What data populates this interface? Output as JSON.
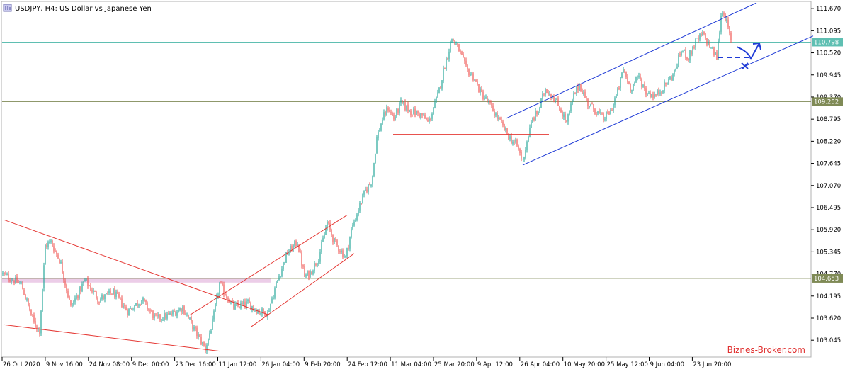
{
  "header": {
    "title": "USDJPY, H4:  US Dollar vs Japanese Yen",
    "icon": "chart-window-icon"
  },
  "watermark": "Biznes-Broker.com",
  "colors": {
    "bull": "#26a69a",
    "bear": "#ef5350",
    "red_line": "#e53935",
    "blue_line": "#1f3bd6",
    "teal_level": "#5fbfb2",
    "olive_level": "#7f8a56",
    "pink_band": "#e9c4e4",
    "label_dark_text": "#ffffff"
  },
  "chart_data": {
    "type": "candlestick",
    "symbol": "USDJPY",
    "timeframe": "H4",
    "ylim": [
      102.68,
      111.82
    ],
    "y_ticks": [
      "111.670",
      "111.095",
      "110.520",
      "109.945",
      "109.370",
      "108.795",
      "108.220",
      "107.645",
      "107.070",
      "106.495",
      "105.920",
      "105.345",
      "104.770",
      "104.195",
      "103.620",
      "103.045"
    ],
    "x_ticks": [
      "26 Oct 2020",
      "9 Nov 16:00",
      "24 Nov 08:00",
      "9 Dec 00:00",
      "23 Dec 16:00",
      "11 Jan 12:00",
      "26 Jan 04:00",
      "9 Feb 20:00",
      "24 Feb 12:00",
      "11 Mar 04:00",
      "25 Mar 20:00",
      "9 Apr 12:00",
      "26 Apr 04:00",
      "10 May 20:00",
      "25 May 12:00",
      "9 Jun 04:00",
      "23 Jun 20:00"
    ],
    "levels": [
      {
        "value": 110.798,
        "label": "110.798",
        "style": "teal"
      },
      {
        "value": 109.252,
        "label": "109.252",
        "style": "olive"
      },
      {
        "value": 104.653,
        "label": "104.653",
        "style": "olive"
      }
    ],
    "close_path": [
      [
        0,
        104.8
      ],
      [
        30,
        104.5
      ],
      [
        48,
        103.5
      ],
      [
        56,
        103.3
      ],
      [
        64,
        105.5
      ],
      [
        72,
        105.6
      ],
      [
        85,
        105.1
      ],
      [
        100,
        103.9
      ],
      [
        120,
        104.6
      ],
      [
        140,
        104.1
      ],
      [
        160,
        104.3
      ],
      [
        180,
        103.8
      ],
      [
        200,
        104.1
      ],
      [
        220,
        103.6
      ],
      [
        240,
        103.7
      ],
      [
        258,
        103.9
      ],
      [
        275,
        103.3
      ],
      [
        290,
        102.82
      ],
      [
        300,
        103.5
      ],
      [
        310,
        104.5
      ],
      [
        330,
        103.9
      ],
      [
        350,
        104.0
      ],
      [
        365,
        103.8
      ],
      [
        378,
        103.75
      ],
      [
        390,
        104.5
      ],
      [
        405,
        105.3
      ],
      [
        420,
        105.6
      ],
      [
        430,
        104.7
      ],
      [
        438,
        104.8
      ],
      [
        450,
        105.2
      ],
      [
        462,
        106.1
      ],
      [
        472,
        105.6
      ],
      [
        480,
        105.4
      ],
      [
        488,
        105.2
      ],
      [
        496,
        105.9
      ],
      [
        505,
        106.4
      ],
      [
        515,
        106.9
      ],
      [
        525,
        107.2
      ],
      [
        532,
        108.3
      ],
      [
        540,
        108.8
      ],
      [
        548,
        109.1
      ],
      [
        556,
        108.8
      ],
      [
        566,
        109.2
      ],
      [
        580,
        109.0
      ],
      [
        595,
        108.9
      ],
      [
        605,
        108.7
      ],
      [
        618,
        109.4
      ],
      [
        628,
        110.2
      ],
      [
        638,
        110.9
      ],
      [
        648,
        110.6
      ],
      [
        658,
        110.1
      ],
      [
        668,
        109.9
      ],
      [
        678,
        109.5
      ],
      [
        690,
        109.2
      ],
      [
        700,
        108.9
      ],
      [
        710,
        108.6
      ],
      [
        720,
        108.3
      ],
      [
        730,
        108.1
      ],
      [
        738,
        107.7
      ],
      [
        745,
        108.3
      ],
      [
        752,
        108.8
      ],
      [
        760,
        109.0
      ],
      [
        770,
        109.6
      ],
      [
        780,
        109.4
      ],
      [
        790,
        109.1
      ],
      [
        800,
        108.7
      ],
      [
        810,
        109.4
      ],
      [
        818,
        109.7
      ],
      [
        830,
        109.2
      ],
      [
        842,
        109.0
      ],
      [
        852,
        108.8
      ],
      [
        862,
        109.0
      ],
      [
        872,
        109.5
      ],
      [
        880,
        110.1
      ],
      [
        890,
        109.6
      ],
      [
        902,
        109.9
      ],
      [
        912,
        109.5
      ],
      [
        925,
        109.4
      ],
      [
        940,
        109.7
      ],
      [
        952,
        110.0
      ],
      [
        962,
        110.6
      ],
      [
        972,
        110.4
      ],
      [
        982,
        110.8
      ],
      [
        992,
        111.0
      ],
      [
        1002,
        110.7
      ],
      [
        1012,
        110.4
      ],
      [
        1018,
        111.5
      ],
      [
        1022,
        111.6
      ],
      [
        1026,
        111.3
      ],
      [
        1032,
        110.8
      ]
    ],
    "trendlines": [
      {
        "color": "red",
        "from": [
          5,
          106.18
        ],
        "to": [
          380,
          103.7
        ]
      },
      {
        "color": "red",
        "from": [
          5,
          103.45
        ],
        "to": [
          310,
          102.76
        ]
      },
      {
        "color": "red",
        "from": [
          268,
          103.7
        ],
        "to": [
          490,
          106.3
        ]
      },
      {
        "color": "red",
        "from": [
          355,
          103.4
        ],
        "to": [
          500,
          105.3
        ]
      },
      {
        "color": "red",
        "from": [
          555,
          108.4
        ],
        "to": [
          775,
          108.4
        ]
      },
      {
        "color": "blue",
        "from": [
          715,
          108.82
        ],
        "to": [
          1068,
          111.82
        ]
      },
      {
        "color": "blue",
        "from": [
          738,
          107.6
        ],
        "to": [
          1148,
          110.96
        ]
      }
    ]
  }
}
